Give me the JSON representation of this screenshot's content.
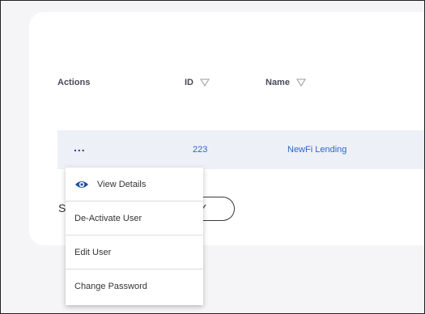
{
  "table": {
    "headers": {
      "actions": "Actions",
      "id": "ID",
      "name": "Name"
    },
    "row": {
      "actions_glyph": "...",
      "id": "223",
      "name": "NewFi Lending"
    }
  },
  "below_card": {
    "partial_text": "S"
  },
  "menu": {
    "items": [
      {
        "label": "View Details",
        "icon": "eye-icon"
      },
      {
        "label": "De-Activate User"
      },
      {
        "label": "Edit User"
      },
      {
        "label": "Change Password"
      }
    ]
  },
  "colors": {
    "link": "#2e67c2",
    "row_highlight": "#eef0f7",
    "eye_icon": "#1f4f9f"
  },
  "icons": {
    "filter": "funnel-icon",
    "pill_chevron": "chevron-down-icon"
  }
}
